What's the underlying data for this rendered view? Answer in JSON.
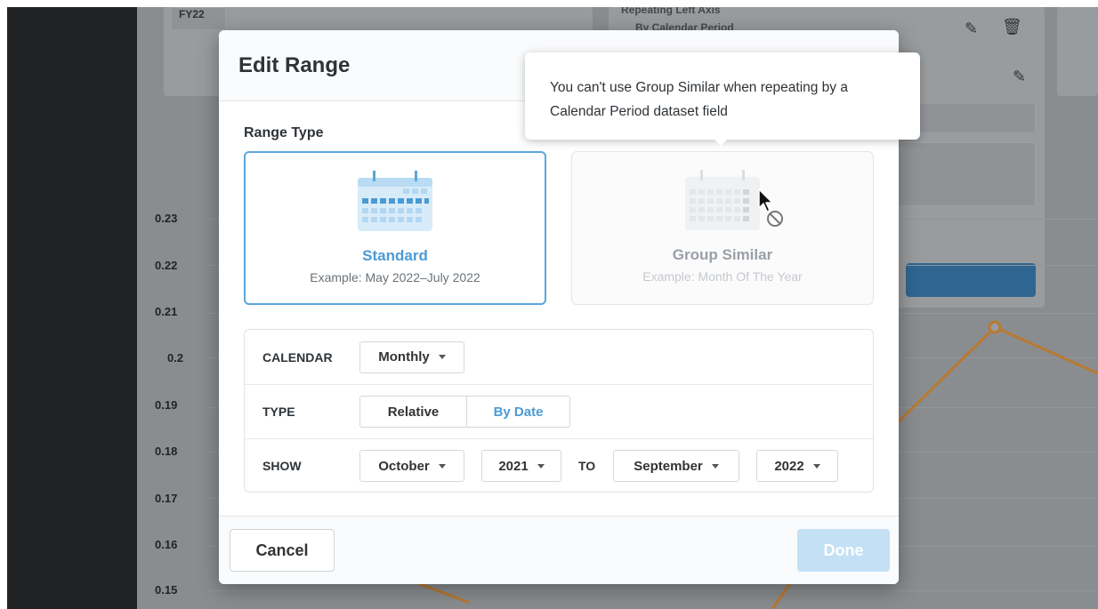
{
  "background": {
    "fy_label": "FY22",
    "panel_title": "Repeating Left Axis",
    "panel_subtitle": "By Calendar Period",
    "y_ticks": [
      "0.23",
      "0.22",
      "0.21",
      "0.2",
      "0.19",
      "0.18",
      "0.17",
      "0.16",
      "0.15"
    ]
  },
  "modal": {
    "title": "Edit Range",
    "range_type_label": "Range Type",
    "options": [
      {
        "name": "Standard",
        "example": "Example: May 2022–July 2022",
        "selected": true
      },
      {
        "name": "Group Similar",
        "example": "Example: Month Of The Year",
        "selected": false,
        "disabled": true
      }
    ],
    "settings": {
      "calendar_label": "CALENDAR",
      "calendar_value": "Monthly",
      "type_label": "TYPE",
      "type_options": [
        "Relative",
        "By Date"
      ],
      "type_selected": "By Date",
      "show_label": "SHOW",
      "from_month": "October",
      "from_year": "2021",
      "to_label": "TO",
      "to_month": "September",
      "to_year": "2022"
    },
    "footer": {
      "cancel_label": "Cancel",
      "done_label": "Done"
    }
  },
  "tooltip": {
    "text": "You can't use Group Similar when repeating by a Calendar Period dataset field"
  },
  "colors": {
    "accent": "#4a9bd4",
    "done_disabled": "#c3e0f5",
    "chart_line": "#e8952a",
    "sidebar": "#202224"
  }
}
